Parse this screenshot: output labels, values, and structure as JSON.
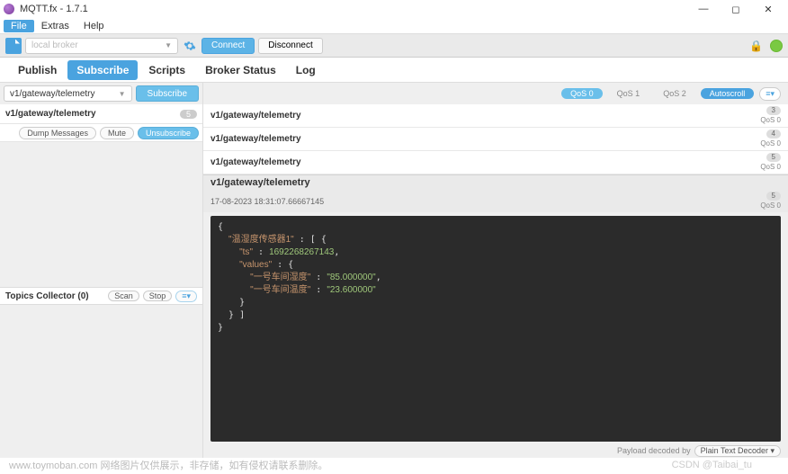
{
  "window": {
    "title": "MQTT.fx - 1.7.1"
  },
  "menu": {
    "file": "File",
    "extras": "Extras",
    "help": "Help"
  },
  "toolbar": {
    "broker_placeholder": "local broker",
    "connect": "Connect",
    "disconnect": "Disconnect"
  },
  "tabs": {
    "publish": "Publish",
    "subscribe": "Subscribe",
    "scripts": "Scripts",
    "broker_status": "Broker Status",
    "log": "Log"
  },
  "subscribe": {
    "topic_input": "v1/gateway/telemetry",
    "subscribe_btn": "Subscribe",
    "topic": {
      "name": "v1/gateway/telemetry",
      "count": "5",
      "dump": "Dump Messages",
      "mute": "Mute",
      "unsubscribe": "Unsubscribe"
    },
    "topics_collector": {
      "label": "Topics Collector (0)",
      "scan": "Scan",
      "stop": "Stop",
      "menu": "≡▾"
    }
  },
  "qos": {
    "q0": "QoS 0",
    "q1": "QoS 1",
    "q2": "QoS 2",
    "autoscroll": "Autoscroll",
    "menu": "≡▾"
  },
  "messages": [
    {
      "topic": "v1/gateway/telemetry",
      "seq": "3",
      "qos": "QoS 0"
    },
    {
      "topic": "v1/gateway/telemetry",
      "seq": "4",
      "qos": "QoS 0"
    },
    {
      "topic": "v1/gateway/telemetry",
      "seq": "5",
      "qos": "QoS 0"
    }
  ],
  "detail": {
    "topic": "v1/gateway/telemetry",
    "timestamp": "17-08-2023  18:31:07.66667145",
    "seq": "5",
    "qos": "QoS 0",
    "payload_label": "Payload decoded by",
    "payload": {
      "sensor_key": "温湿度传感器1",
      "ts_key": "ts",
      "ts_val": "1692268267143",
      "values_key": "values",
      "k1": "一号车间湿度",
      "v1": "85.000000",
      "k2": "一号车间温度",
      "v2": "23.600000"
    }
  },
  "watermark": {
    "left": "www.toymoban.com  网络图片仅供展示，非存储，如有侵权请联系删除。",
    "right": "CSDN @Taibai_tu"
  }
}
